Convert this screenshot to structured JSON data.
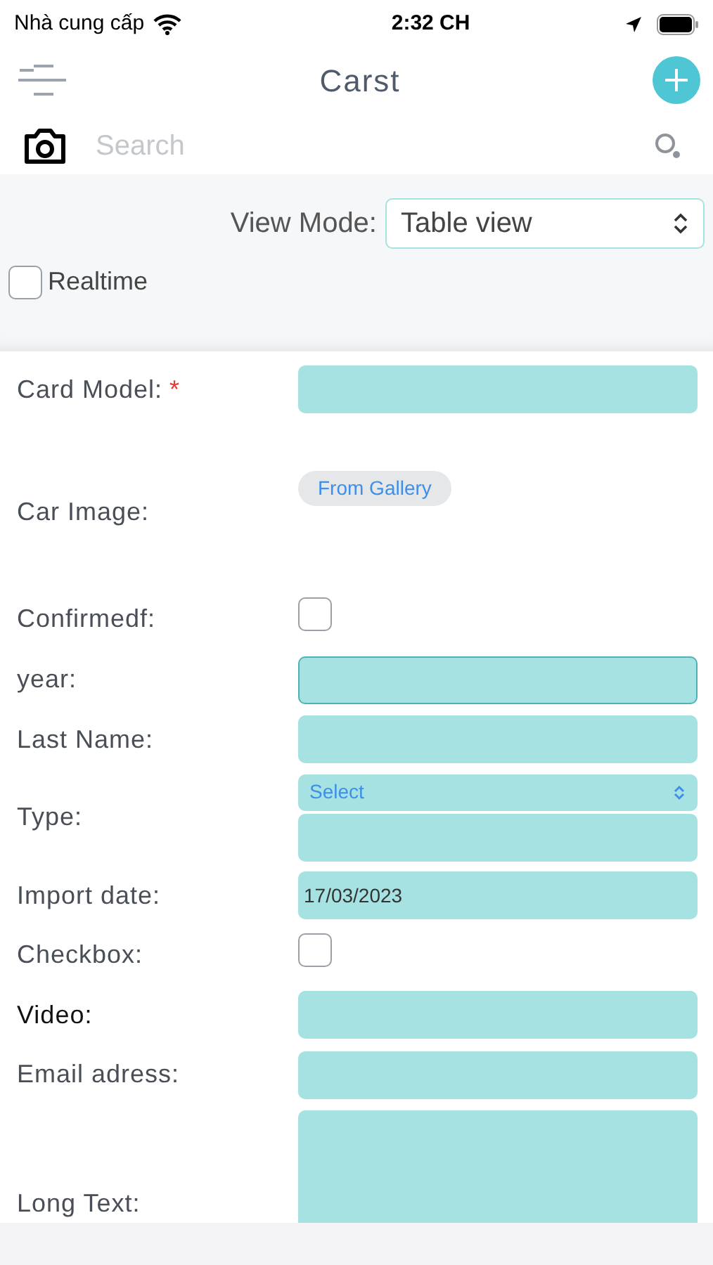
{
  "status_bar": {
    "carrier": "Nhà cung cấp",
    "time": "2:32 CH"
  },
  "nav": {
    "title": "Carst"
  },
  "search": {
    "placeholder": "Search"
  },
  "view_mode": {
    "label": "View Mode:",
    "value": "Table view"
  },
  "realtime": {
    "label": "Realtime",
    "checked": false
  },
  "form": [
    {
      "kind": "text",
      "label": "Card Model:",
      "required": "*",
      "focused": false
    },
    {
      "kind": "image",
      "label": "Car Image:",
      "button": "From Gallery"
    },
    {
      "kind": "checkbox",
      "label": "Confirmedf:",
      "checked": false
    },
    {
      "kind": "text",
      "label": "year:",
      "focused": true
    },
    {
      "kind": "text",
      "label": "Last Name:",
      "focused": false
    },
    {
      "kind": "select",
      "label": "Type:",
      "placeholder": "Select"
    },
    {
      "kind": "text",
      "label": "Import date:",
      "value": "17/03/2023",
      "focused": false
    },
    {
      "kind": "checkbox",
      "label": "Checkbox:",
      "checked": false
    },
    {
      "kind": "text",
      "label": "Video:",
      "dark": true,
      "focused": false
    },
    {
      "kind": "text",
      "label": "Email adress:",
      "focused": false
    },
    {
      "kind": "textarea",
      "label": "Long Text:"
    }
  ]
}
